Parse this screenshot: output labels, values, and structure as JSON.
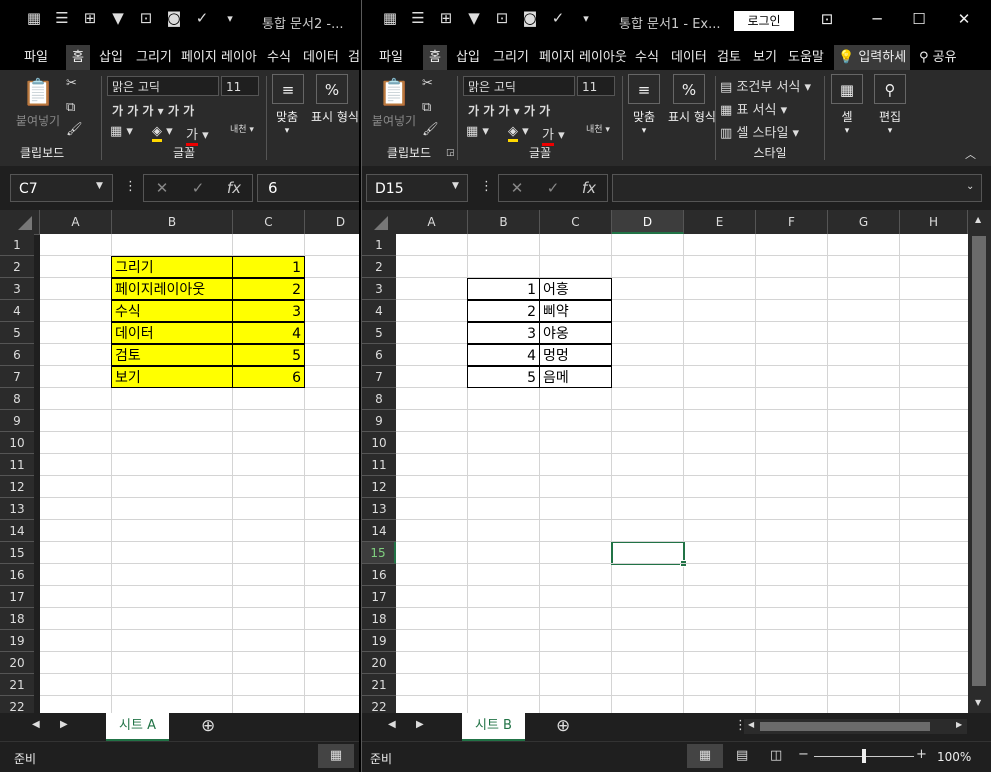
{
  "winA": {
    "title": "통합 문서2  -...",
    "tabs": [
      "파일",
      "홈",
      "삽입",
      "그리기",
      "페이지 레이아",
      "수식",
      "데이터",
      "검"
    ],
    "ribbon": {
      "paste_label": "붙여넣기",
      "clipboard_label": "클립보드",
      "font_name": "맑은 고딕",
      "font_size": "11",
      "font_label": "글꼴",
      "align_label": "맞춤",
      "number_label": "표시 형식",
      "percent": "%"
    },
    "name_box": "C7",
    "formula": "6",
    "columns": [
      "A",
      "B",
      "C",
      "D"
    ],
    "rows": [
      "1",
      "2",
      "3",
      "4",
      "5",
      "6",
      "7",
      "8",
      "9",
      "10",
      "11",
      "12",
      "13",
      "14",
      "15",
      "16",
      "17",
      "18",
      "19",
      "20",
      "21",
      "22"
    ],
    "data": [
      {
        "b": "그리기",
        "c": "1"
      },
      {
        "b": "페이지레이아웃",
        "c": "2"
      },
      {
        "b": "수식",
        "c": "3"
      },
      {
        "b": "데이터",
        "c": "4"
      },
      {
        "b": "검토",
        "c": "5"
      },
      {
        "b": "보기",
        "c": "6"
      }
    ],
    "sheet_tab": "시트 A",
    "status": "준비"
  },
  "winB": {
    "title": "통합 문서1  -  Ex...",
    "login": "로그인",
    "tabs": [
      "파일",
      "홈",
      "삽입",
      "그리기",
      "페이지 레이아웃",
      "수식",
      "데이터",
      "검토",
      "보기",
      "도움말",
      "입력하세",
      "공유"
    ],
    "ribbon": {
      "paste_label": "붙여넣기",
      "clipboard_label": "클립보드",
      "font_name": "맑은 고딕",
      "font_size": "11",
      "font_label": "글꼴",
      "align_label": "맞춤",
      "number_label": "표시 형식",
      "percent": "%",
      "cond_format": "조건부 서식",
      "table_format": "표 서식",
      "cell_style": "셀 스타일",
      "styles_label": "스타일",
      "cells_label": "셀",
      "edit_label": "편집"
    },
    "name_box": "D15",
    "formula": "",
    "columns": [
      "A",
      "B",
      "C",
      "D",
      "E",
      "F",
      "G",
      "H"
    ],
    "rows": [
      "1",
      "2",
      "3",
      "4",
      "5",
      "6",
      "7",
      "8",
      "9",
      "10",
      "11",
      "12",
      "13",
      "14",
      "15",
      "16",
      "17",
      "18",
      "19",
      "20",
      "21",
      "22"
    ],
    "data": [
      {
        "b": "1",
        "c": "어흥"
      },
      {
        "b": "2",
        "c": "삐약"
      },
      {
        "b": "3",
        "c": "야옹"
      },
      {
        "b": "4",
        "c": "멍멍"
      },
      {
        "b": "5",
        "c": "음메"
      }
    ],
    "sheet_tab": "시트 B",
    "status": "준비",
    "zoom": "100%"
  },
  "colors": {
    "accent": "#217346",
    "highlight": "#ffff00"
  }
}
